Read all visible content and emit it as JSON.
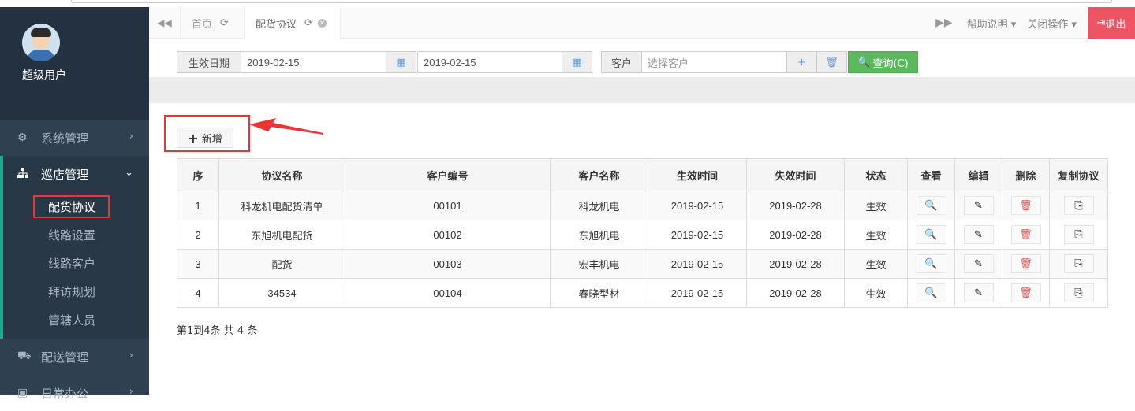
{
  "user": {
    "name": "超级用户"
  },
  "nav": {
    "items": [
      {
        "label": "系统管理",
        "icon": "cogs-icon"
      },
      {
        "label": "巡店管理",
        "icon": "sitemap-icon"
      },
      {
        "label": "配送管理",
        "icon": "truck-icon"
      },
      {
        "label": "日常办公",
        "icon": "briefcase-icon"
      }
    ],
    "sub": [
      "配货协议",
      "线路设置",
      "线路客户",
      "拜访规划",
      "管辖人员"
    ]
  },
  "tabs": [
    {
      "label": "首页"
    },
    {
      "label": "配货协议"
    }
  ],
  "topbar": {
    "help": "帮助说明",
    "close_ops": "关闭操作",
    "logout": "退出"
  },
  "search": {
    "date_label": "生效日期",
    "date_from": "2019-02-15",
    "date_to": "2019-02-15",
    "customer_label": "客户",
    "customer_placeholder": "选择客户",
    "query_label": "查询(C)"
  },
  "toolbar": {
    "add_label": "新增"
  },
  "table": {
    "headers": [
      "序",
      "协议名称",
      "客户编号",
      "客户名称",
      "生效时间",
      "失效时间",
      "状态",
      "查看",
      "编辑",
      "删除",
      "复制协议"
    ],
    "rows": [
      {
        "seq": "1",
        "name": "科龙机电配货清单",
        "code": "00101",
        "customer": "科龙机电",
        "start": "2019-02-15",
        "end": "2019-02-28",
        "status": "生效"
      },
      {
        "seq": "2",
        "name": "东旭机电配货",
        "code": "00102",
        "customer": "东旭机电",
        "start": "2019-02-15",
        "end": "2019-02-28",
        "status": "生效"
      },
      {
        "seq": "3",
        "name": "配货",
        "code": "00103",
        "customer": "宏丰机电",
        "start": "2019-02-15",
        "end": "2019-02-28",
        "status": "生效"
      },
      {
        "seq": "4",
        "name": "34534",
        "code": "00104",
        "customer": "春晓型材",
        "start": "2019-02-15",
        "end": "2019-02-28",
        "status": "生效"
      }
    ]
  },
  "pagination": {
    "info": "第1到4条 共 4 条"
  },
  "colors": {
    "sidebar": "#2f4050",
    "accent": "#19aa8d",
    "logout": "#ed5565",
    "query": "#5cb85c",
    "highlight": "#ee3333"
  }
}
